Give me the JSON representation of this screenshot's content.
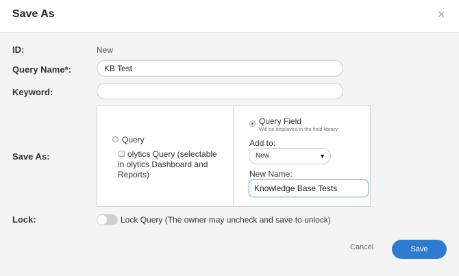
{
  "dialog": {
    "title": "Save As",
    "close_glyph": "×",
    "close_icon": "close-icon"
  },
  "form": {
    "id_label": "ID:",
    "id_value": "New",
    "query_name_label": "Query Name*:",
    "query_name_value": "KB Test",
    "keyword_label": "Keyword:",
    "keyword_value": "",
    "save_as_label": "Save As:",
    "lock_label": "Lock:"
  },
  "save_as": {
    "query_option_label": "Query",
    "query_option_selected": false,
    "analytics_checkbox_label": "olytics Query (selectable in olytics Dashboard and Reports)",
    "analytics_checked": false,
    "query_field_option_label": "Query Field",
    "query_field_option_selected": true,
    "query_field_hint": "Will be displayed in the field library",
    "add_to_label": "Add to:",
    "add_to_selected": "New",
    "new_name_label": "New Name:",
    "new_name_value": "Knowledge Base Tests"
  },
  "lock": {
    "toggle_on": false,
    "description": "Lock Query (The owner may uncheck and save to unlock)"
  },
  "footer": {
    "cancel_label": "Cancel",
    "save_label": "Save"
  },
  "colors": {
    "primary": "#2f7bd1",
    "focus_border": "#8fb9e0",
    "background": "#f4f4f5"
  }
}
